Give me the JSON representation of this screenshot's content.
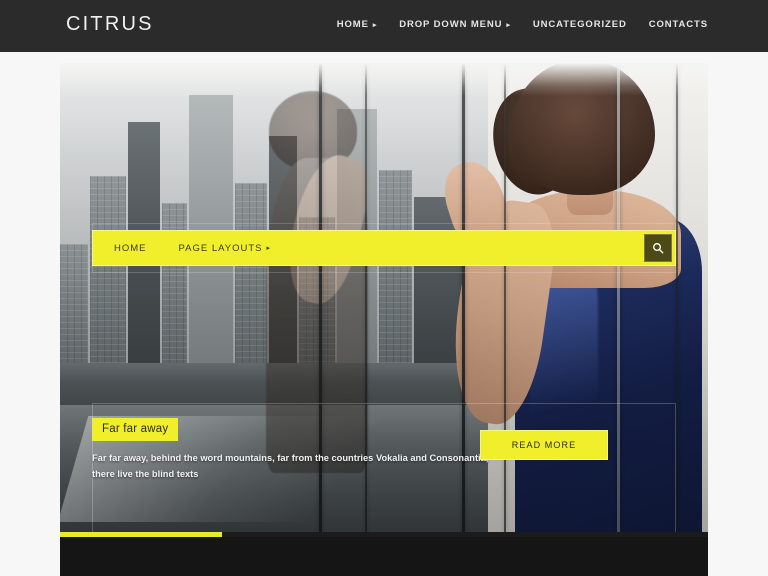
{
  "site": {
    "logo": "CITRUS",
    "accent_yellow": "#F1EF2C",
    "header_bg": "#2B2B2B",
    "footer_bg": "#151515"
  },
  "header": {
    "nav": [
      {
        "label": "HOME",
        "caret": "▸",
        "has_caret": true
      },
      {
        "label": "DROP DOWN MENU",
        "caret": "▸",
        "has_caret": true
      },
      {
        "label": "UNCATEGORIZED",
        "caret": "",
        "has_caret": false
      },
      {
        "label": "CONTACTS",
        "caret": "",
        "has_caret": false
      }
    ]
  },
  "yellow_bar": {
    "links": [
      {
        "label": "HOME",
        "caret": ""
      },
      {
        "label": "PAGE LAYOUTS",
        "caret": "▸"
      }
    ],
    "search_icon": "search-icon"
  },
  "hero": {
    "caption_title": "Far far away",
    "caption_text": "Far far away, behind the word mountains, far from the countries Vokalia and Consonantia, there live the blind texts",
    "read_more": "READ MORE"
  },
  "slider": {
    "progress_percent": 25
  }
}
